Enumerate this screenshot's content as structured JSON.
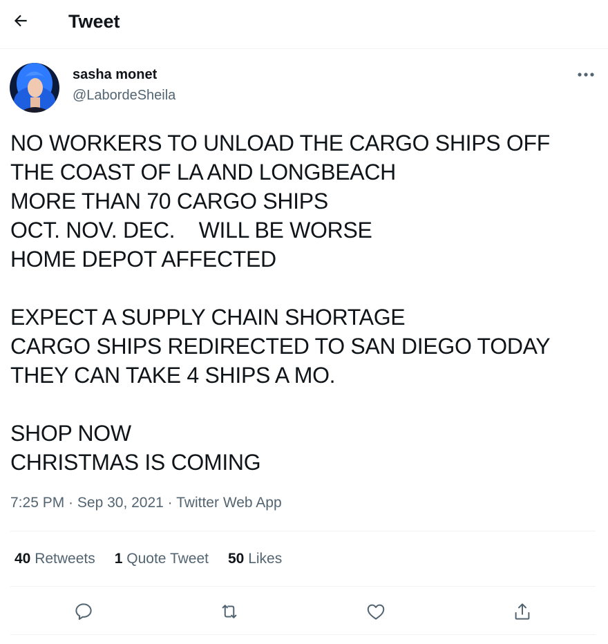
{
  "header": {
    "title": "Tweet",
    "back_icon": "arrow-left-icon"
  },
  "tweet": {
    "author_name": "sasha monet",
    "author_handle": "@LabordeSheila",
    "text_lines": [
      "NO WORKERS TO UNLOAD THE CARGO SHIPS OFF",
      "THE COAST OF LA AND LONGBEACH",
      "MORE THAN 70 CARGO SHIPS",
      "OCT. NOV. DEC.    WILL BE WORSE",
      "HOME DEPOT AFFECTED",
      "",
      "EXPECT A SUPPLY CHAIN SHORTAGE",
      "CARGO SHIPS REDIRECTED TO SAN DIEGO TODAY",
      "THEY CAN TAKE 4 SHIPS A MO.",
      "",
      "SHOP NOW",
      "CHRISTMAS IS COMING"
    ],
    "time": "7:25 PM",
    "date": "Sep 30, 2021",
    "source": "Twitter Web App",
    "separator": " · "
  },
  "stats": {
    "retweets_count": "40",
    "retweets_label": "Retweets",
    "quotes_count": "1",
    "quotes_label": "Quote Tweet",
    "likes_count": "50",
    "likes_label": "Likes"
  },
  "actions": [
    "reply-icon",
    "retweet-icon",
    "like-icon",
    "share-icon"
  ],
  "colors": {
    "text": "#0f1419",
    "secondary": "#536471",
    "divider": "#eff3f4",
    "avatar_hair": "#2f7bff"
  }
}
